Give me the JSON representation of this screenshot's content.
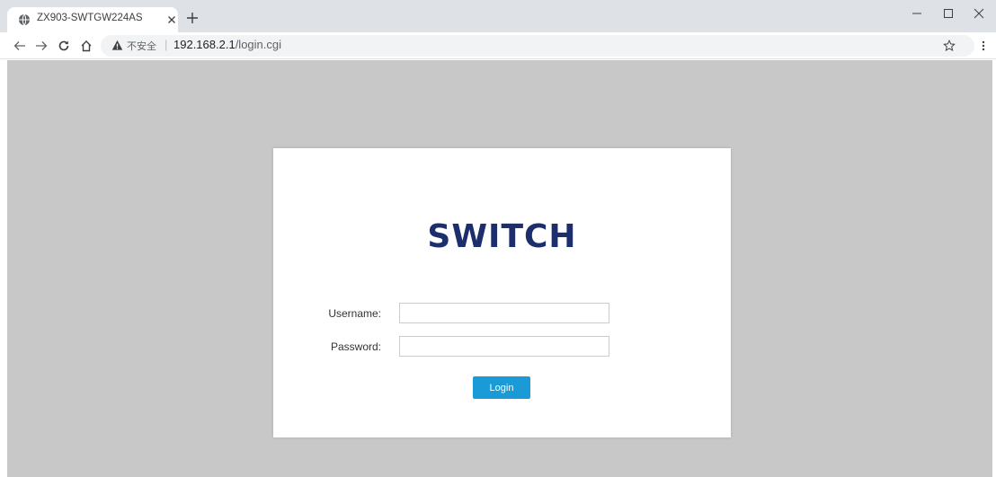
{
  "browser": {
    "tab": {
      "title": "ZX903-SWTGW224AS",
      "favicon": "globe-icon"
    },
    "address": {
      "security_label": "不安全",
      "separator": "|",
      "host": "192.168.2.1",
      "path": "/login.cgi"
    },
    "icons": [
      "back-arrow-icon",
      "forward-arrow-icon",
      "reload-icon",
      "home-icon",
      "warning-icon",
      "star-icon",
      "menu-icon",
      "minimize-icon",
      "maximize-icon",
      "close-icon",
      "plus-icon"
    ]
  },
  "login": {
    "logo_text": "SWITCH",
    "username_label": "Username:",
    "password_label": "Password:",
    "username_value": "",
    "password_value": "",
    "button_label": "Login"
  },
  "colors": {
    "logo": "#1c2e6b",
    "button": "#1a9ad6",
    "page_background": "#c8c8c8"
  }
}
